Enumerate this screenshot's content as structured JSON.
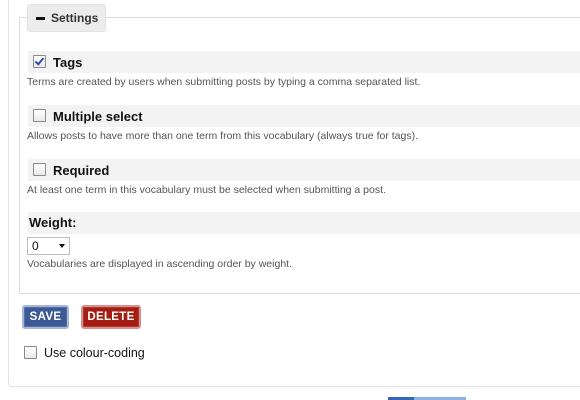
{
  "settings": {
    "legend_label": "Settings",
    "options": [
      {
        "label": "Tags",
        "checked": true,
        "description": "Terms are created by users when submitting posts by typing a comma separated list."
      },
      {
        "label": "Multiple select",
        "checked": false,
        "description": "Allows posts to have more than one term from this vocabulary (always true for tags)."
      },
      {
        "label": "Required",
        "checked": false,
        "description": "At least one term in this vocabulary must be selected when submitting a post."
      }
    ],
    "weight": {
      "label": "Weight:",
      "value": "0",
      "description": "Vocabularies are displayed in ascending order by weight."
    }
  },
  "actions": {
    "save_label": "SAVE",
    "delete_label": "DELETE"
  },
  "colour_coding": {
    "label": "Use colour-coding",
    "checked": false
  },
  "icons": {
    "collapse": "collapse-minus-icon",
    "dropdown": "chevron-down-icon"
  },
  "colors": {
    "save_button": "#3d5a96",
    "delete_button": "#a31d12",
    "legend_bg": "#ececec",
    "row_band": "#f3f3f3"
  }
}
